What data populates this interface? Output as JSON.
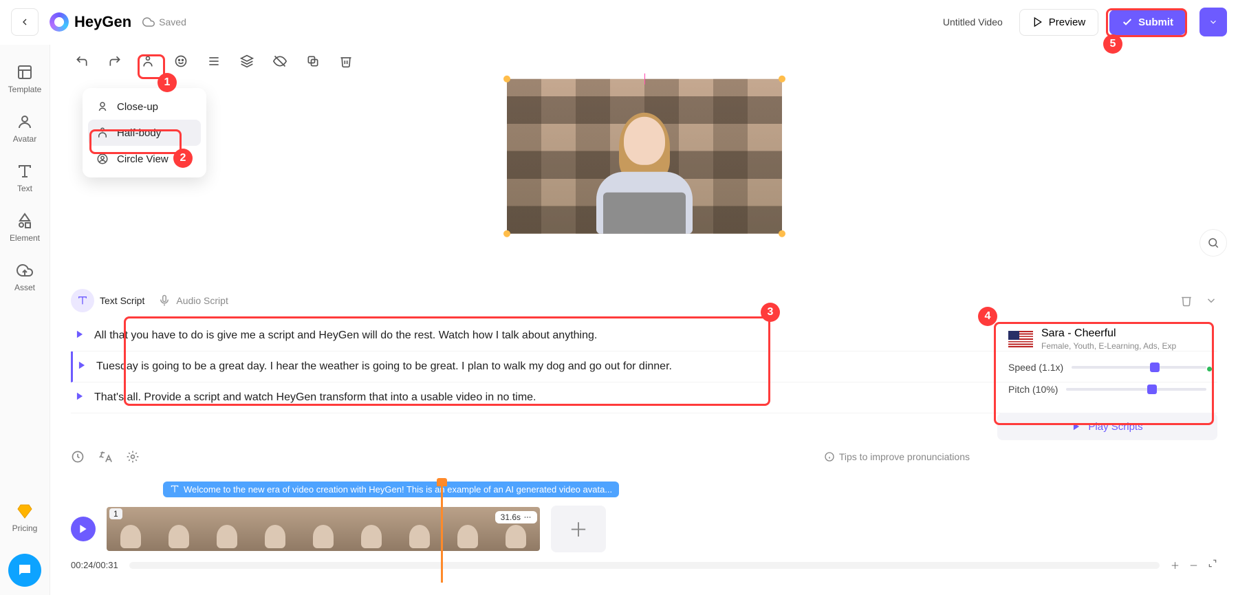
{
  "header": {
    "brand": "HeyGen",
    "saved_label": "Saved",
    "title": "Untitled Video",
    "preview_label": "Preview",
    "submit_label": "Submit"
  },
  "sidebar": {
    "items": [
      {
        "label": "Template"
      },
      {
        "label": "Avatar"
      },
      {
        "label": "Text"
      },
      {
        "label": "Element"
      },
      {
        "label": "Asset"
      }
    ],
    "pricing_label": "Pricing"
  },
  "view_dropdown": {
    "items": [
      "Close-up",
      "Half-body",
      "Circle View"
    ],
    "selected_index": 1
  },
  "tabs": {
    "text_label": "Text Script",
    "audio_label": "Audio Script"
  },
  "script_lines": [
    "All that you have to do is give me a script and HeyGen will do the rest. Watch how I talk about anything.",
    "Tuesday is going to be a great day. I hear the weather is going to be great. I plan to walk my dog and go out for dinner.",
    "That's all. Provide a script and watch HeyGen transform that into a usable video in no time."
  ],
  "tips_label": "Tips to improve pronunciations",
  "voice": {
    "name": "Sara - Cheerful",
    "meta": "Female, Youth, E-Learning, Ads, Exp",
    "speed_label": "Speed (1.1x)",
    "pitch_label": "Pitch (10%)",
    "speed_pct": 58,
    "pitch_pct": 58,
    "play_scripts_label": "Play Scripts"
  },
  "timeline": {
    "subtitle": "Welcome to the new era of video creation with HeyGen! This is an example of an AI generated video avata...",
    "clip_index": "1",
    "duration_label": "31.6s",
    "time_display": "00:24/00:31",
    "playhead_pct": 77
  },
  "badges": [
    "1",
    "2",
    "3",
    "4",
    "5"
  ]
}
